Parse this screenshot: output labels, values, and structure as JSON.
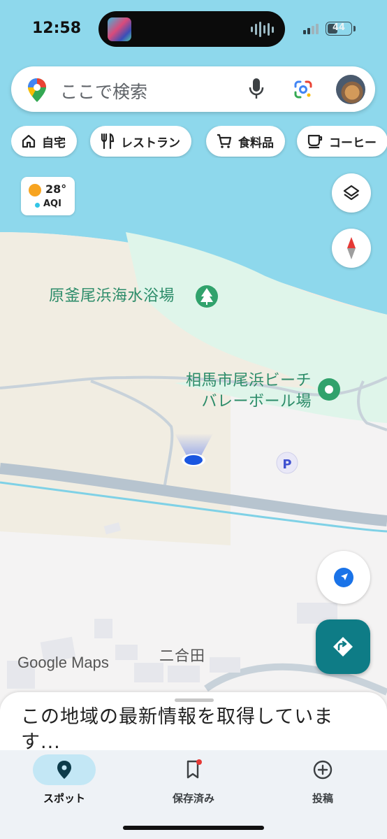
{
  "status_bar": {
    "time": "12:58",
    "battery_level": "44"
  },
  "search": {
    "placeholder": "ここで検索"
  },
  "chips": [
    {
      "label": "自宅",
      "icon": "home-icon"
    },
    {
      "label": "レストラン",
      "icon": "fork-knife-icon"
    },
    {
      "label": "食料品",
      "icon": "cart-icon"
    },
    {
      "label": "コーヒー",
      "icon": "coffee-cup-icon"
    }
  ],
  "weather": {
    "temperature": "28°",
    "aqi_label": "AQI"
  },
  "map": {
    "labels": {
      "beach": "原釜尾浜海水浴場",
      "volleyball_line1": "相馬市尾浜ビーチ",
      "volleyball_line2": "バレーボール場",
      "town": "二合田"
    },
    "parking_label": "P",
    "logo_google": "Google",
    "logo_maps": "Maps"
  },
  "sheet": {
    "message": "この地域の最新情報を取得しています..."
  },
  "tabs": [
    {
      "label": "スポット",
      "icon": "pin-icon",
      "active": true
    },
    {
      "label": "保存済み",
      "icon": "bookmark-icon",
      "active": false
    },
    {
      "label": "投稿",
      "icon": "plus-circle-icon",
      "active": false
    }
  ],
  "colors": {
    "water": "#8ed8ec",
    "sand": "#f1ede2",
    "park": "#dff5ea",
    "road": "#b7c4cf",
    "accent_teal": "#0e7c86",
    "location_blue": "#1a56e0"
  }
}
